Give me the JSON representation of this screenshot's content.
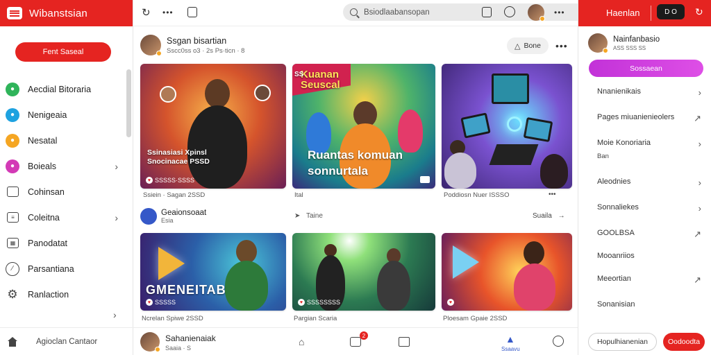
{
  "left_panel": {
    "brand": "Wibanstsian",
    "cta": "Fent Saseal",
    "nav": [
      {
        "label": "Aecdial Bitoraria",
        "icon": "green-circle-icon",
        "color": "#2fb45a"
      },
      {
        "label": "Nenigeaia",
        "icon": "blue-circle-icon",
        "color": "#1ea2e0"
      },
      {
        "label": "Nesatal",
        "icon": "orange-circle-icon",
        "color": "#f5a623"
      },
      {
        "label": "Boieals",
        "icon": "pink-circle-icon",
        "color": "#d33ab6",
        "chevron": true
      },
      {
        "label": "Cohinsan",
        "icon": "card-icon"
      },
      {
        "label": "Coleitna",
        "icon": "clipboard-icon",
        "chevron": true
      },
      {
        "label": "Panodatat",
        "icon": "calendar-icon"
      },
      {
        "label": "Parsantiana",
        "icon": "ban-icon"
      },
      {
        "label": "Ranlaction",
        "icon": "gear-icon"
      }
    ],
    "footer_label": "Agioclan Cantaor"
  },
  "topbar": {
    "search_placeholder": "Bsiodlaabansopan"
  },
  "feed": {
    "post1": {
      "author": "Ssgan bisartian",
      "meta": "Sscc0ss o3 · 2s  Ps·ticn  ·  8",
      "follow_label": "Bone"
    },
    "cards_top": [
      {
        "overlay": "Ssinasiasi Xpinsl\nSnocinacae PSSD",
        "caption": "Ssiein · Sagan 2SSD",
        "badge": "SSSSS·SSSS"
      },
      {
        "overlay": "Ruantas komuan\nsonnurtala",
        "banner": "Kuanan\nSeuscal",
        "caption": "Ital",
        "corner": "SS"
      },
      {
        "overlay": "",
        "caption": "Poddiosn Nuer ISSSO"
      }
    ],
    "section": {
      "author": "Geaionsoaat",
      "sub": "Esia",
      "middle_label": "Taine",
      "right_label": "Suaila"
    },
    "cards_bottom": [
      {
        "overlay": "GMENEITAB",
        "caption": "Ncrelan Spiwe 2SSD",
        "badge": "SSSSS"
      },
      {
        "overlay": "",
        "caption": "Pargian Scaria",
        "badge": "SSSSSSSS"
      },
      {
        "overlay": "",
        "caption": "Ploesam Gpaie 2SSD"
      }
    ],
    "footer": {
      "author": "Sahanienaiak",
      "meta": "Saaia  ·  S",
      "active_tab": "Ssaavu",
      "notif_count": "2"
    }
  },
  "right_panel": {
    "title": "Haenlan",
    "pill_label": "D  O",
    "user": "Nainfanbasio",
    "user_sub": "ASS  SSS  SS",
    "purple_btn": "Sossaean",
    "list": [
      {
        "label": "Nnanienikais",
        "gap": 37
      },
      {
        "label": "Pages miuanienieolers",
        "gap": 37
      },
      {
        "label": "Moie Konoriaria",
        "sub": "Ban",
        "gap": 56
      },
      {
        "label": "Aleodnies",
        "gap": 37
      },
      {
        "label": "Sonnaliekes",
        "gap": 37
      },
      {
        "label": "GOOLBSA",
        "gap": 33
      },
      {
        "label": "Mooanriios",
        "gap": 33
      },
      {
        "label": "Meeortian",
        "gap": 37
      },
      {
        "label": "Sonanisian",
        "gap": 37
      }
    ],
    "footer_outline": "Hopulhianenian",
    "footer_red": "Oodoodta"
  }
}
